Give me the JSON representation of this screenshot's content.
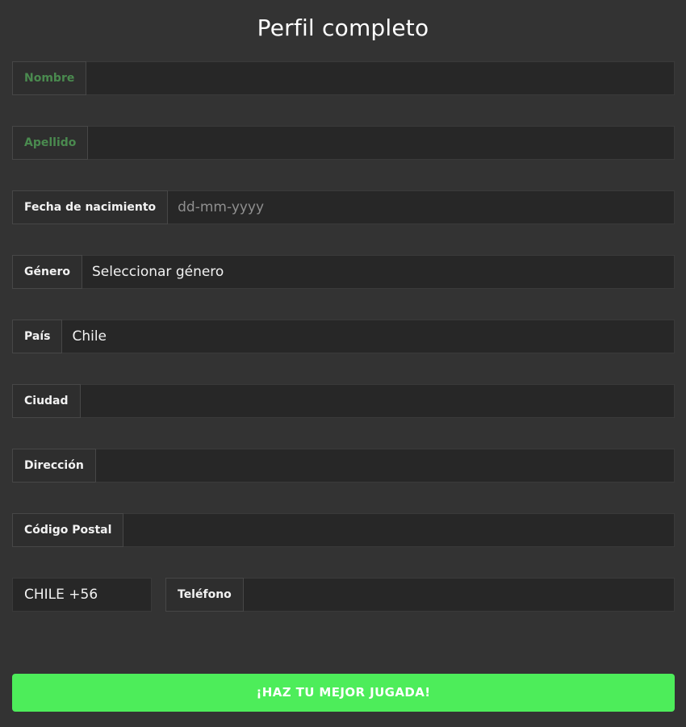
{
  "page": {
    "title": "Perfil completo",
    "background_color": "#333333",
    "accent_color": "#4ded5a"
  },
  "form": {
    "rows": [
      {
        "id": "nombre",
        "label": "Nombre",
        "label_style": "green",
        "value": "",
        "placeholder": "",
        "type": "text"
      },
      {
        "id": "apellido",
        "label": "Apellido",
        "label_style": "green",
        "value": "",
        "placeholder": "",
        "type": "text"
      },
      {
        "id": "fecha-de-nacimiento",
        "label": "Fecha de nacimiento",
        "label_style": "white",
        "value": "",
        "placeholder": "dd-mm-yyyy",
        "type": "date"
      },
      {
        "id": "genero",
        "label": "Género",
        "label_style": "white",
        "value": "Seleccionar género",
        "placeholder": "",
        "type": "select"
      },
      {
        "id": "pais",
        "label": "País",
        "label_style": "white",
        "value": "Chile",
        "placeholder": "",
        "type": "select"
      },
      {
        "id": "ciudad",
        "label": "Ciudad",
        "label_style": "white",
        "value": "",
        "placeholder": "",
        "type": "text"
      },
      {
        "id": "direccion",
        "label": "Dirección",
        "label_style": "white",
        "value": "",
        "placeholder": "",
        "type": "text"
      },
      {
        "id": "codigo-postal",
        "label": "Código Postal",
        "label_style": "white",
        "value": "",
        "placeholder": "",
        "type": "text"
      }
    ],
    "phone": {
      "country_code": "CHILE +56",
      "label": "Teléfono",
      "value": "",
      "placeholder": ""
    }
  },
  "submit": {
    "label": "¡HAZ TU MEJOR JUGADA!"
  }
}
